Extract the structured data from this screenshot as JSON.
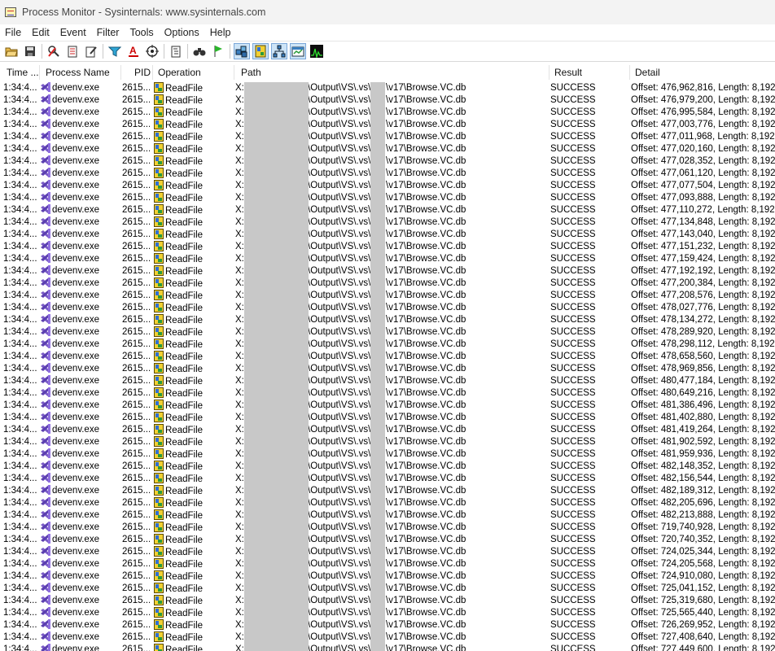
{
  "window": {
    "title": "Process Monitor - Sysinternals: www.sysinternals.com"
  },
  "menu": [
    "File",
    "Edit",
    "Event",
    "Filter",
    "Tools",
    "Options",
    "Help"
  ],
  "toolbar": {
    "buttons": [
      "open-icon",
      "save-icon",
      "|",
      "capture-icon",
      "autoscroll-icon",
      "clear-icon",
      "|",
      "filter-icon",
      "highlight-icon",
      "target-icon",
      "|",
      "process-tree-icon",
      "|",
      "find-icon",
      "jump-icon",
      "|",
      "registry-activity-icon",
      "file-activity-icon",
      "network-activity-icon",
      "process-activity-icon",
      "profiling-activity-icon"
    ],
    "active": [
      "registry-activity-icon",
      "file-activity-icon",
      "network-activity-icon",
      "process-activity-icon"
    ]
  },
  "columns": [
    "Time ...",
    "Process Name",
    "PID",
    "Operation",
    "Path",
    "Result",
    "Detail"
  ],
  "common": {
    "time": "1:34:4...",
    "process": "devenv.exe",
    "pid": "2615...",
    "operation": "ReadFile",
    "path_part1": "X:\\",
    "path_part2": "\\Output\\VS\\.vs\\",
    "path_part3": "\\v17\\Browse.VC.db",
    "result": "SUCCESS"
  },
  "details": [
    "Offset: 476,962,816, Length: 8,192",
    "Offset: 476,979,200, Length: 8,192",
    "Offset: 476,995,584, Length: 8,192",
    "Offset: 477,003,776, Length: 8,192",
    "Offset: 477,011,968, Length: 8,192",
    "Offset: 477,020,160, Length: 8,192",
    "Offset: 477,028,352, Length: 8,192",
    "Offset: 477,061,120, Length: 8,192",
    "Offset: 477,077,504, Length: 8,192",
    "Offset: 477,093,888, Length: 8,192",
    "Offset: 477,110,272, Length: 8,192",
    "Offset: 477,134,848, Length: 8,192",
    "Offset: 477,143,040, Length: 8,192",
    "Offset: 477,151,232, Length: 8,192",
    "Offset: 477,159,424, Length: 8,192",
    "Offset: 477,192,192, Length: 8,192",
    "Offset: 477,200,384, Length: 8,192",
    "Offset: 477,208,576, Length: 8,192",
    "Offset: 478,027,776, Length: 8,192",
    "Offset: 478,134,272, Length: 8,192",
    "Offset: 478,289,920, Length: 8,192",
    "Offset: 478,298,112, Length: 8,192",
    "Offset: 478,658,560, Length: 8,192",
    "Offset: 478,969,856, Length: 8,192",
    "Offset: 480,477,184, Length: 8,192",
    "Offset: 480,649,216, Length: 8,192",
    "Offset: 481,386,496, Length: 8,192",
    "Offset: 481,402,880, Length: 8,192",
    "Offset: 481,419,264, Length: 8,192",
    "Offset: 481,902,592, Length: 8,192",
    "Offset: 481,959,936, Length: 8,192",
    "Offset: 482,148,352, Length: 8,192",
    "Offset: 482,156,544, Length: 8,192",
    "Offset: 482,189,312, Length: 8,192",
    "Offset: 482,205,696, Length: 8,192",
    "Offset: 482,213,888, Length: 8,192",
    "Offset: 719,740,928, Length: 8,192",
    "Offset: 720,740,352, Length: 8,192",
    "Offset: 724,025,344, Length: 8,192",
    "Offset: 724,205,568, Length: 8,192",
    "Offset: 724,910,080, Length: 8,192",
    "Offset: 725,041,152, Length: 8,192",
    "Offset: 725,319,680, Length: 8,192",
    "Offset: 725,565,440, Length: 8,192",
    "Offset: 726,269,952, Length: 8,192",
    "Offset: 727,408,640, Length: 8,192",
    "Offset: 727,449,600, Length: 8,192"
  ]
}
